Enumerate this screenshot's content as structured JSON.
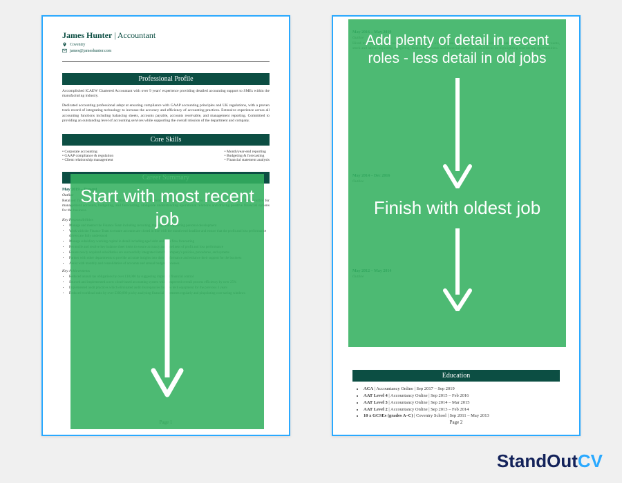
{
  "cv": {
    "name": "James Hunter",
    "role": "Accountant",
    "location": "Coventry",
    "email": "james@jameshunter.com",
    "sections": {
      "profile_title": "Professional Profile",
      "profile_p1": "Accomplished ICAEW Chartered Accountant with over 9 years' experience providing detailed accounting support to SMEs within the manufacturing industry.",
      "profile_p2": "Dedicated accounting professional adept at ensuring compliance with GAAP accounting principles and UK regulations, with a proven track record of integrating technology to increase the accuracy and efficiency of accounting practices. Extensive experience across all accounting functions including balancing sheets, accounts payable, accounts receivable, and management reporting. Committed to providing an outstanding level of accounting services while supporting the overall mission of the department and company.",
      "core_skills_title": "Core Skills",
      "core_skills_left": [
        "Corporate accounting",
        "GAAP compliance & regulation",
        "Client relationship management"
      ],
      "core_skills_right": [
        "Month/year-end reporting",
        "Budgeting & forecasting",
        "Financial statement analysis"
      ],
      "career_title": "Career Summary",
      "job1_dates": "May 2019 – Present",
      "job1_outline": "Outline",
      "job1_outline_text": "Retained for a market-leading manufacturing business to head up accounts, reporting to the Financial Controller. Responsible for management accounts, budgeting, and forecasting, alongside understanding operational relations and driving positive financial options for the business.",
      "job1_resp_title": "Key Responsibilities",
      "job1_resp": [
        "Manage and mentor the Finance Team including recruiting, training, and supporting personal development",
        "Work with the Finance Team to ensure accounts are closed in line with the month-end deadline and ensure that the profit and loss performance drivers are fully understood",
        "Manage subsidiary working capital in detail including aged debt and cash flow forecasting",
        "Reconcile and resolve key balance sheet items to ensure accuracy and timeliness of profit and loss performance",
        "Ensure newly acquired subsidiaries are successfully integrated into the company's policies, procedures, and systems",
        "Partner with other departments to provide accurate insights into their performance and enhance their support for the business",
        "Assist with monthly and consolidation of accounts and annual budget processes"
      ],
      "job1_ach_title": "Key Achievements",
      "job1_ach": [
        "Reduced annual tax obligations by over £10,000 by suggesting improved financial control",
        "Sourced and implemented a new cloud-based accounting system which improved overall process efficiency by over 25%",
        "Implemented audit practices which eliminated audit discrepancies for new tech equipment for the previous 3 years",
        "Reduced workload ratio by over £300,000 p/a by analysing financial statements regularly and pinpointing cost-saving windows"
      ],
      "education_title": "Education",
      "education": [
        {
          "qual": "ACA",
          "school": "Accountancy Online",
          "dates": "Sep 2017 – Sep 2019"
        },
        {
          "qual": "AAT Level 4",
          "school": "Accountancy Online",
          "dates": "Sep 2015 – Feb 2016"
        },
        {
          "qual": "AAT Level 3",
          "school": "Accountancy Online",
          "dates": "Sep 2014 – Mar 2015"
        },
        {
          "qual": "AAT Level 2",
          "school": "Accountancy Online",
          "dates": "Sep 2013 – Feb 2014"
        },
        {
          "qual": "10 x GCSEs (grades A–C)",
          "school": "Coventry School",
          "dates": "Sep 2011 – May 2013"
        }
      ]
    },
    "page1_num": "Page 1",
    "page2_num": "Page 2"
  },
  "annotations": {
    "p1_text": "Start with most recent job",
    "p2_top": "Add plenty of detail in recent roles - less detail in old jobs",
    "p2_bottom": "Finish with oldest job"
  },
  "branding": {
    "word1": "StandOut",
    "word2": "CV"
  }
}
